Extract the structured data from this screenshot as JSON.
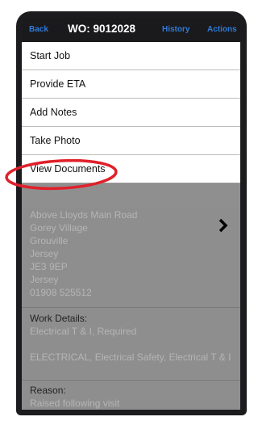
{
  "header": {
    "back_label": "Back",
    "title": "WO: 9012028",
    "history_label": "History",
    "actions_label": "Actions"
  },
  "menu": {
    "items": [
      {
        "label": "Start Job"
      },
      {
        "label": "Provide ETA"
      },
      {
        "label": "Add Notes"
      },
      {
        "label": "Take Photo"
      },
      {
        "label": "View Documents"
      }
    ]
  },
  "address": {
    "lines": [
      "Above Lloyds Main Road",
      "Gorey Village",
      "Grouville",
      "Jersey",
      "JE3 9EP",
      "Jersey",
      "01908 525512"
    ]
  },
  "work_details": {
    "title": "Work Details:",
    "line1": "Electrical T & I, Required",
    "line2": "ELECTRICAL, Electrical Safety, Electrical T & I"
  },
  "reason": {
    "title": "Reason:",
    "text": "Raised following visit"
  },
  "colors": {
    "header_bg": "#1a1a1c",
    "header_link": "#2f7bd9",
    "highlight_circle": "#e0202a"
  },
  "icons": {
    "chevron": "chevron-right-icon"
  }
}
